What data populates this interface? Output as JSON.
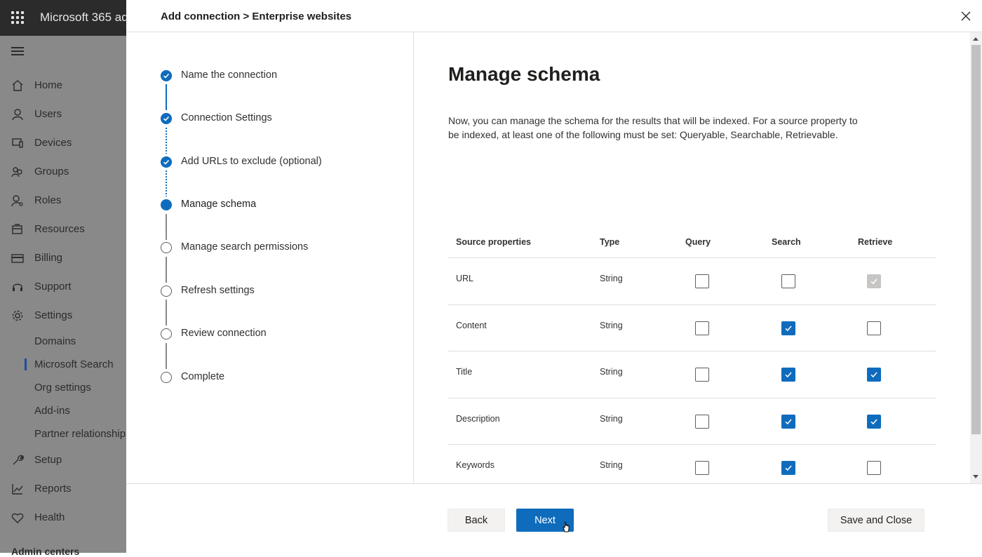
{
  "app": {
    "title": "Microsoft 365 ad",
    "admin_footer": "Admin centers"
  },
  "nav": {
    "items": [
      {
        "label": "Home",
        "icon": "home-icon"
      },
      {
        "label": "Users",
        "icon": "user-icon"
      },
      {
        "label": "Devices",
        "icon": "devices-icon"
      },
      {
        "label": "Groups",
        "icon": "groups-icon"
      },
      {
        "label": "Roles",
        "icon": "roles-icon"
      },
      {
        "label": "Resources",
        "icon": "resources-icon"
      },
      {
        "label": "Billing",
        "icon": "billing-icon"
      },
      {
        "label": "Support",
        "icon": "headset-icon"
      },
      {
        "label": "Settings",
        "icon": "gear-icon"
      }
    ],
    "settings_subitems": [
      "Domains",
      "Microsoft Search",
      "Org settings",
      "Add-ins",
      "Partner relationships"
    ],
    "bottom_items": [
      {
        "label": "Setup",
        "icon": "wrench-icon"
      },
      {
        "label": "Reports",
        "icon": "chart-icon"
      },
      {
        "label": "Health",
        "icon": "heart-icon"
      }
    ]
  },
  "panel": {
    "breadcrumb": "Add connection > Enterprise websites",
    "steps": [
      {
        "label": "Name the connection",
        "state": "done"
      },
      {
        "label": "Connection Settings",
        "state": "done"
      },
      {
        "label": "Add URLs to exclude (optional)",
        "state": "done"
      },
      {
        "label": "Manage schema",
        "state": "current"
      },
      {
        "label": "Manage search permissions",
        "state": "todo"
      },
      {
        "label": "Refresh settings",
        "state": "todo"
      },
      {
        "label": "Review connection",
        "state": "todo"
      },
      {
        "label": "Complete",
        "state": "todo"
      }
    ],
    "title": "Manage schema",
    "description": "Now, you can manage the schema for the results that will be indexed. For a source property to be indexed, at least one of the following must be set: Queryable, Searchable, Retrievable.",
    "table": {
      "headers": [
        "Source properties",
        "Type",
        "Query",
        "Search",
        "Retrieve"
      ],
      "rows": [
        {
          "property": "URL",
          "type": "String",
          "query": false,
          "search": false,
          "retrieve": "disabled-checked"
        },
        {
          "property": "Content",
          "type": "String",
          "query": false,
          "search": true,
          "retrieve": false
        },
        {
          "property": "Title",
          "type": "String",
          "query": false,
          "search": true,
          "retrieve": true
        },
        {
          "property": "Description",
          "type": "String",
          "query": false,
          "search": true,
          "retrieve": true
        },
        {
          "property": "Keywords",
          "type": "String",
          "query": false,
          "search": true,
          "retrieve": false
        }
      ]
    },
    "buttons": {
      "back": "Back",
      "next": "Next",
      "save_close": "Save and Close"
    }
  },
  "colors": {
    "accent": "#0f6cbd",
    "nav_dim": "#898989",
    "topbar": "#2b2b2b"
  }
}
